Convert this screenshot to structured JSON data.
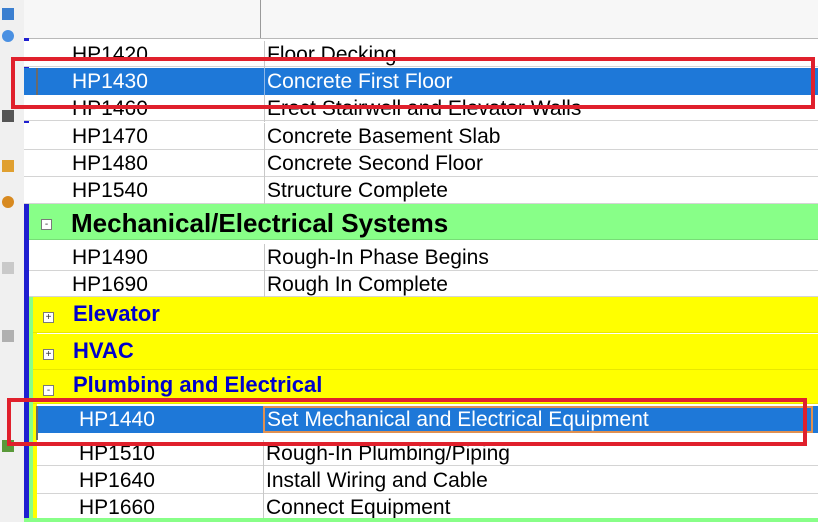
{
  "colors": {
    "wbs_level1": "#88ff88",
    "wbs_level2": "#ffff00",
    "wbs_level2_text": "#0000cc",
    "selected_row": "#1e78d8",
    "highlight_box": "#e0202c"
  },
  "toolbar_icons": [
    "document-icon",
    "tool-icon",
    "edit-icon",
    "filter-icon",
    "pin-icon",
    "shape-icon",
    "grid-icon",
    "arrow-icon"
  ],
  "groups": {
    "mech_elec": {
      "label": "Mechanical/Electrical Systems",
      "toggle": "-"
    },
    "elevator": {
      "label": "Elevator",
      "toggle": "+"
    },
    "hvac": {
      "label": "HVAC",
      "toggle": "+"
    },
    "plumbing": {
      "label": "Plumbing and Electrical",
      "toggle": "-"
    }
  },
  "rows": [
    {
      "id": "HP1420",
      "name": "Floor Decking"
    },
    {
      "id": "HP1430",
      "name": "Concrete First Floor"
    },
    {
      "id": "HP1460",
      "name": "Erect Stairwell and Elevator Walls"
    },
    {
      "id": "HP1470",
      "name": "Concrete Basement Slab"
    },
    {
      "id": "HP1480",
      "name": "Concrete Second Floor"
    },
    {
      "id": "HP1540",
      "name": "Structure Complete"
    },
    {
      "id": "HP1490",
      "name": "Rough-In Phase Begins"
    },
    {
      "id": "HP1690",
      "name": "Rough In Complete"
    },
    {
      "id": "HP1440",
      "name": "Set Mechanical and Electrical Equipment"
    },
    {
      "id": "HP1510",
      "name": "Rough-In Plumbing/Piping"
    },
    {
      "id": "HP1640",
      "name": "Install Wiring and Cable"
    },
    {
      "id": "HP1660",
      "name": "Connect Equipment"
    }
  ]
}
